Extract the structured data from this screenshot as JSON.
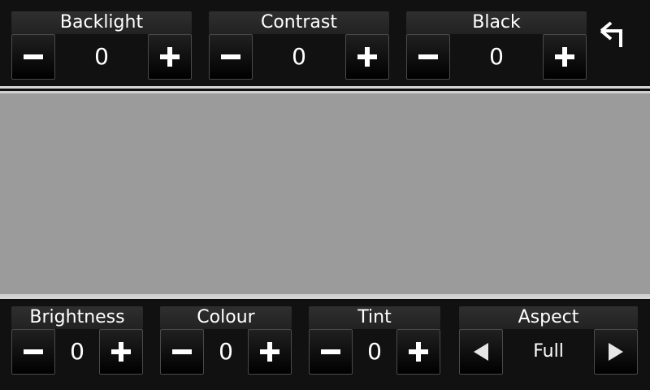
{
  "top": [
    {
      "label": "Backlight",
      "value": "0"
    },
    {
      "label": "Contrast",
      "value": "0"
    },
    {
      "label": "Black",
      "value": "0"
    }
  ],
  "bottom": [
    {
      "label": "Brightness",
      "value": "0"
    },
    {
      "label": "Colour",
      "value": "0"
    },
    {
      "label": "Tint",
      "value": "0"
    }
  ],
  "aspect": {
    "label": "Aspect",
    "value": "Full"
  },
  "icons": {
    "minus": "minus-icon",
    "plus": "plus-icon",
    "left": "left-arrow-icon",
    "right": "right-arrow-icon",
    "back": "back-arrow-icon"
  }
}
